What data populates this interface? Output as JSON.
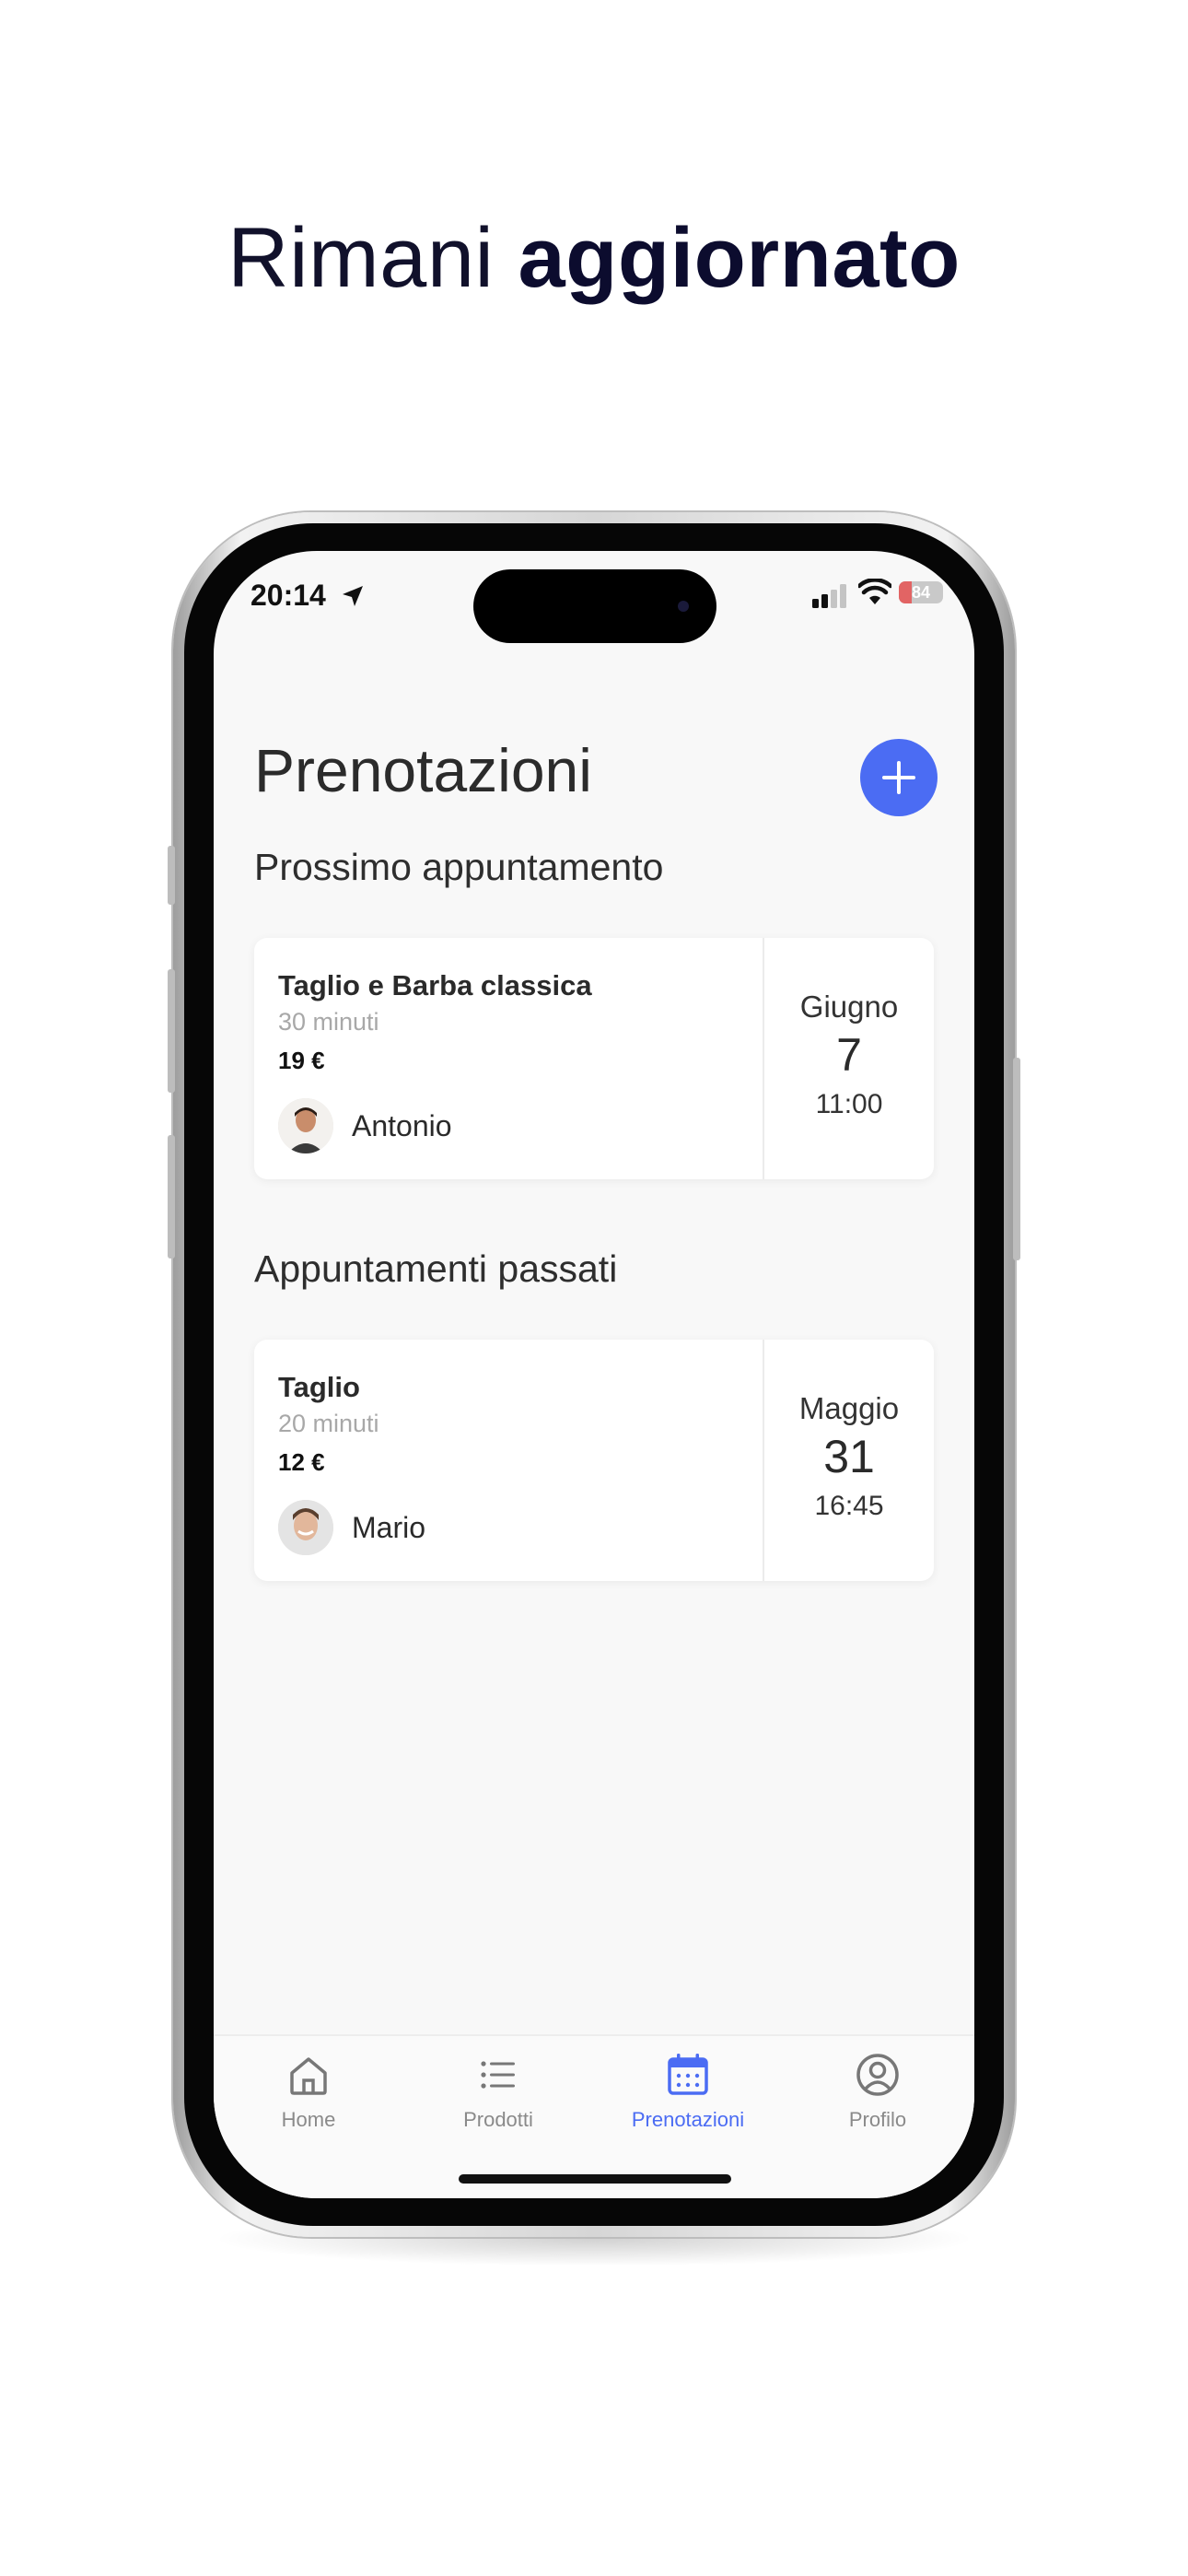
{
  "headline": {
    "regular": "Rimani",
    "bold": "aggiornato"
  },
  "status_bar": {
    "time": "20:14",
    "battery": "84"
  },
  "page": {
    "title": "Prenotazioni"
  },
  "upcoming": {
    "section_title": "Prossimo appuntamento",
    "service": "Taglio e Barba classica",
    "duration": "30 minuti",
    "price": "19 €",
    "barber": "Antonio",
    "month": "Giugno",
    "day": "7",
    "time": "11:00"
  },
  "past": {
    "section_title": "Appuntamenti passati",
    "service": "Taglio",
    "duration": "20 minuti",
    "price": "12 €",
    "barber": "Mario",
    "month": "Maggio",
    "day": "31",
    "time": "16:45"
  },
  "tabs": [
    {
      "label": "Home",
      "icon": "home-icon"
    },
    {
      "label": "Prodotti",
      "icon": "list-icon"
    },
    {
      "label": "Prenotazioni",
      "icon": "calendar-icon",
      "active": true
    },
    {
      "label": "Profilo",
      "icon": "profile-icon"
    }
  ],
  "colors": {
    "accent": "#4b6cf3",
    "headline": "#0c0c2e"
  }
}
